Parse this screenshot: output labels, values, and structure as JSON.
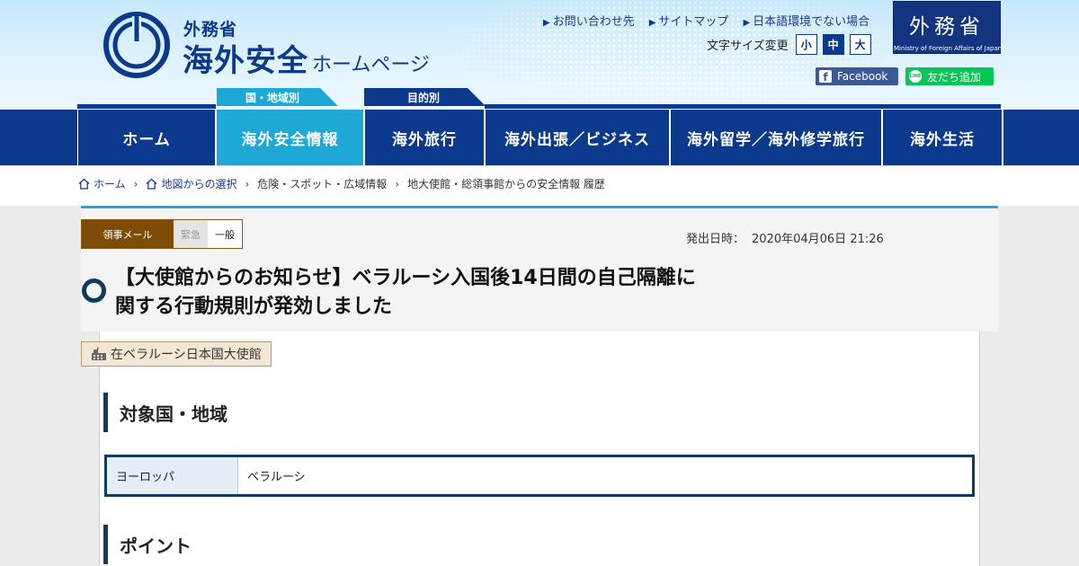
{
  "header": {
    "ministry_kanji": "外務省",
    "site_title": "海外安全",
    "site_subtitle": "ホームページ",
    "util_links": [
      "お問い合わせ先",
      "サイトマップ",
      "日本語環境でない場合"
    ],
    "font_size_label": "文字サイズ変更",
    "font_sizes": [
      "小",
      "中",
      "大"
    ],
    "font_size_selected": "中",
    "mofa_kanji": "外務省",
    "mofa_english": "Ministry of Foreign Affairs of Japan",
    "facebook_label": "Facebook",
    "line_icon_text": "LINE",
    "line_label": "友だち追加",
    "flag_region": "国・地域別",
    "flag_purpose": "目的別"
  },
  "nav": {
    "items": [
      "ホーム",
      "海外安全情報",
      "海外旅行",
      "海外出張／ビジネス",
      "海外留学／海外修学旅行",
      "海外生活"
    ],
    "active": "海外安全情報"
  },
  "breadcrumb": {
    "items": [
      "ホーム",
      "地図からの選択",
      "危険・スポット・広域情報",
      "地大使館・総領事館からの安全情報 履歴"
    ]
  },
  "article": {
    "tags": [
      "領事メール",
      "緊急",
      "一般"
    ],
    "issued_label": "発出日時：",
    "issued_value": "2020年04月06日 21:26",
    "title_line1": "【大使館からのお知らせ】ベラルーシ入国後14日間の自己隔離に",
    "title_line2": "関する行動規則が発効しました",
    "embassy": "在ベラルーシ日本国大使館",
    "section_target": "対象国・地域",
    "region": "ヨーロッパ",
    "country": "ベラルーシ",
    "section_point": "ポイント"
  },
  "colors": {
    "navy": "#0b3a8c",
    "accent_cyan": "#1ea8d6",
    "consular_brown": "#7e4c07",
    "section_navy": "#123a5e"
  }
}
